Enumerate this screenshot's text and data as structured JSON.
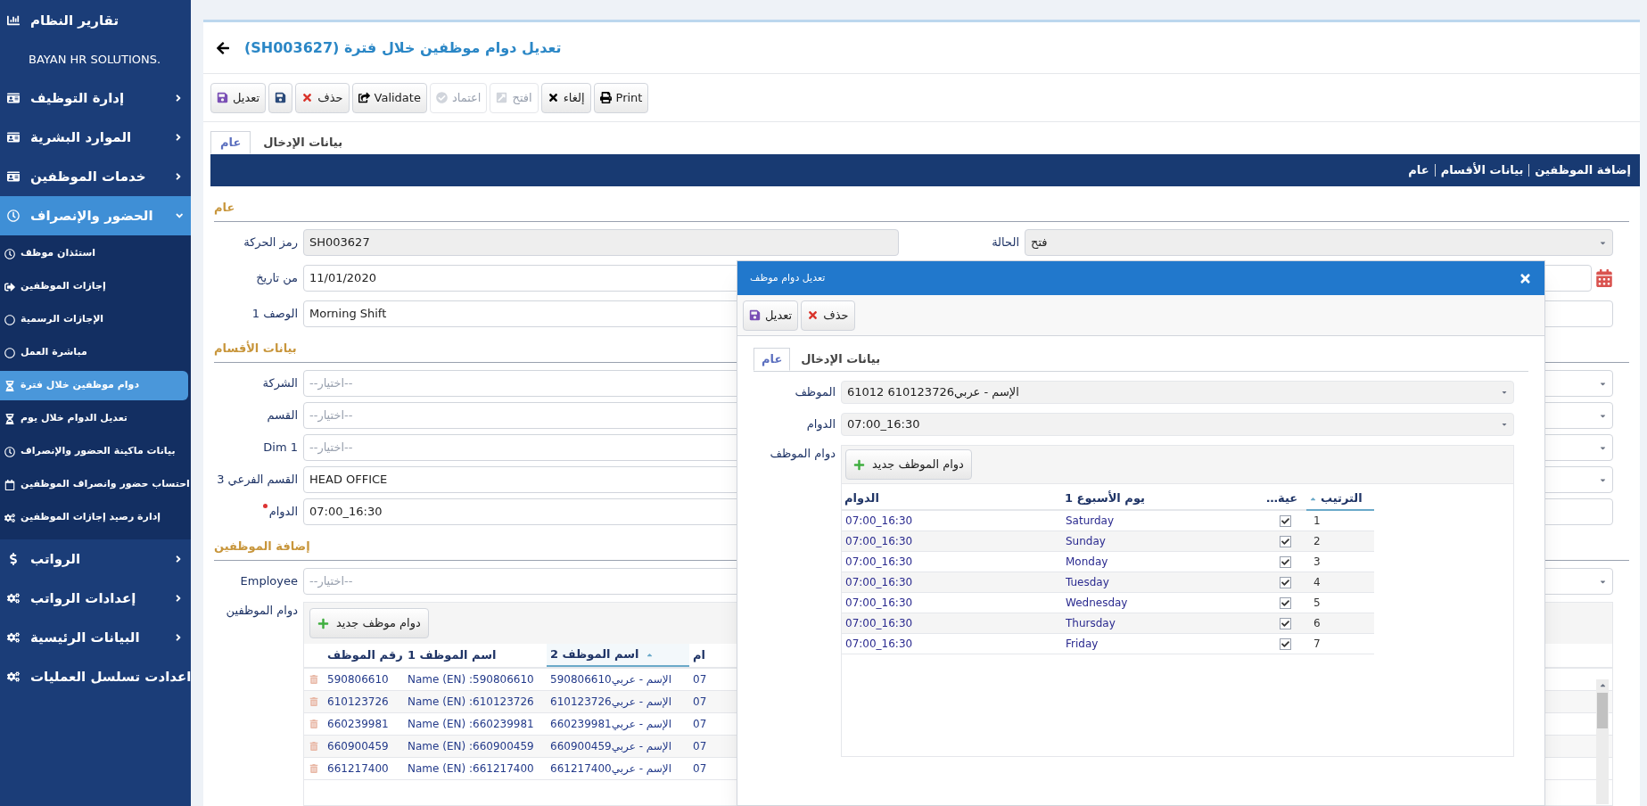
{
  "sidebar": {
    "header": "تقارير النظام",
    "brand": "BAYAN HR SOLUTIONS.",
    "items": [
      {
        "label": "إدارة التوظيف",
        "expanded": false
      },
      {
        "label": "الموارد البشرية",
        "expanded": false
      },
      {
        "label": "خدمات الموظفين",
        "expanded": false
      },
      {
        "label": "الحضور والإنصراف",
        "expanded": true,
        "children": [
          {
            "label": "استئذان موظف",
            "selected": false
          },
          {
            "label": "إجازات الموظفين",
            "selected": false
          },
          {
            "label": "الإجازات الرسمية",
            "selected": false
          },
          {
            "label": "مباشرة العمل",
            "selected": false
          },
          {
            "label": "دوام موظفين خلال فترة",
            "selected": true
          },
          {
            "label": "تعديل الدوام خلال يوم",
            "selected": false
          },
          {
            "label": "بيانات ماكينة الحضور والإنصراف",
            "selected": false
          },
          {
            "label": "احتساب حضور وانصراف الموظفين",
            "selected": false
          },
          {
            "label": "إدارة رصيد إجازات الموظفين",
            "selected": false
          }
        ]
      },
      {
        "label": "الرواتب",
        "expanded": false
      },
      {
        "label": "إعدادات الرواتب",
        "expanded": false
      },
      {
        "label": "البيانات الرئيسية",
        "expanded": false
      },
      {
        "label": "اعدادت تسلسل العمليات",
        "expanded": false
      }
    ]
  },
  "page": {
    "title": "تعديل دوام موظفين خلال فترة (SH003627)"
  },
  "toolbar": [
    {
      "label": "Print",
      "disabled": false
    },
    {
      "label": "إلغاء",
      "disabled": false
    },
    {
      "label": "افتح",
      "disabled": true
    },
    {
      "label": "اعتماد",
      "disabled": true
    },
    {
      "label": "Validate",
      "disabled": false
    },
    {
      "label": "حذف",
      "disabled": false
    },
    {
      "disabled": false
    },
    {
      "label": "تعديل",
      "disabled": false
    }
  ],
  "tabs": [
    {
      "label": "بيانات الإدخال",
      "selected": false
    },
    {
      "label": "عام",
      "selected": true
    }
  ],
  "breadcrumbs": [
    "إضافة الموظفين",
    "بيانات الأقسام",
    "عام"
  ],
  "general": {
    "title": "عام",
    "code": {
      "label": "رمز الحركة",
      "value": "SH003627"
    },
    "status": {
      "label": "الحالة",
      "value": "فتح"
    },
    "from_date": {
      "label": "من تاريخ",
      "value": "11/01/2020"
    },
    "description": {
      "label": "الوصف 1",
      "value": "Morning Shift"
    }
  },
  "departments": {
    "title": "بيانات الأقسام",
    "fields": [
      {
        "label": "الشركة",
        "placeholder": "--اختيار--",
        "kind": "select",
        "required": false
      },
      {
        "label": "القسم",
        "placeholder": "--اختيار--",
        "kind": "select",
        "required": false
      },
      {
        "label": "Dim 1",
        "placeholder": "--اختيار--",
        "kind": "select",
        "required": false
      },
      {
        "label": "القسم الفرعي 3",
        "value": "HEAD OFFICE",
        "kind": "select",
        "required": false
      },
      {
        "label": "الدوام",
        "value": "07:00_16:30",
        "kind": "text",
        "required": true
      }
    ]
  },
  "employees": {
    "title": "إضافة الموظفين",
    "employee": {
      "label": "Employee",
      "placeholder": "--اختيار--"
    },
    "grid_label": "دوام الموظفين",
    "new_button": "دوام موظف جديد",
    "columns": [
      {
        "label": "ام",
        "sorted": false
      },
      {
        "label": "اسم الموظف 2",
        "sorted": true
      },
      {
        "label": "اسم الموظف 1",
        "sorted": false
      },
      {
        "label": "رقم الموظف",
        "sorted": false
      }
    ],
    "rows": [
      [
        "07",
        "الإسم - عربي590806610",
        "Name (EN) :590806610",
        "590806610"
      ],
      [
        "07",
        "الإسم - عربي610123726",
        "Name (EN) :610123726",
        "610123726"
      ],
      [
        "07",
        "الإسم - عربي660239981",
        "Name (EN) :660239981",
        "660239981"
      ],
      [
        "07",
        "الإسم - عربي660900459",
        "Name (EN) :660900459",
        "660900459"
      ],
      [
        "07",
        "الإسم - عربي661217400",
        "Name (EN) :661217400",
        "661217400"
      ]
    ]
  },
  "dialog": {
    "title": "تعديل دوام موظف",
    "toolbar": [
      {
        "label": "حذف"
      },
      {
        "label": "تعديل"
      }
    ],
    "tabs": [
      {
        "label": "بيانات الإدخال",
        "selected": false
      },
      {
        "label": "عام",
        "selected": true
      }
    ],
    "fields": [
      {
        "label": "الموظف",
        "value": "الإسم - عربي610123726 61012"
      },
      {
        "label": "الدوام",
        "value": "07:00_16:30"
      }
    ],
    "grid_label": "دوام الموظف",
    "new_button": "دوام الموظف جديد",
    "columns": [
      {
        "label": "الترتيب",
        "sorted": true
      },
      {
        "label": "عية…",
        "sorted": false
      },
      {
        "label": "يوم الأسبوع 1",
        "sorted": false
      },
      {
        "label": "الدوام",
        "sorted": false
      }
    ],
    "rows": [
      {
        "order": "1",
        "checked": true,
        "day": "Saturday",
        "shift": "07:00_16:30"
      },
      {
        "order": "2",
        "checked": true,
        "day": "Sunday",
        "shift": "07:00_16:30"
      },
      {
        "order": "3",
        "checked": true,
        "day": "Monday",
        "shift": "07:00_16:30"
      },
      {
        "order": "4",
        "checked": true,
        "day": "Tuesday",
        "shift": "07:00_16:30"
      },
      {
        "order": "5",
        "checked": true,
        "day": "Wednesday",
        "shift": "07:00_16:30"
      },
      {
        "order": "6",
        "checked": true,
        "day": "Thursday",
        "shift": "07:00_16:30"
      },
      {
        "order": "7",
        "checked": true,
        "day": "Friday",
        "shift": "07:00_16:30"
      }
    ]
  }
}
